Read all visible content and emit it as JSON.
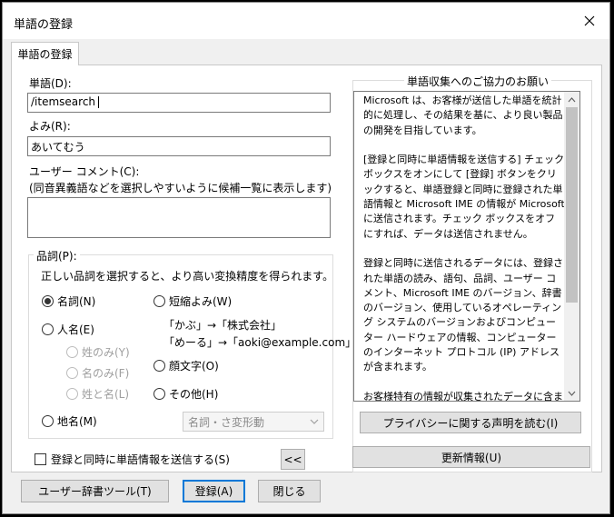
{
  "window": {
    "title": "単語の登録"
  },
  "tab": {
    "label": "単語の登録"
  },
  "word": {
    "label": "単語(D):",
    "value": "/itemsearch"
  },
  "reading": {
    "label": "よみ(R):",
    "value": "あいてむう"
  },
  "comment": {
    "label": "ユーザー コメント(C):",
    "hint": "(同音異義語などを選択しやすいように候補一覧に表示します)",
    "value": ""
  },
  "pos": {
    "title": "品詞(P):",
    "description": "正しい品詞を選択すると、より高い変換精度を得られます。",
    "noun": "名詞(N)",
    "person": "人名(E)",
    "surname_only": "姓のみ(Y)",
    "given_only": "名のみ(F)",
    "surname_given": "姓と名(L)",
    "place": "地名(M)",
    "abbrev": "短縮よみ(W)",
    "abbrev_example1": "「かぶ」→「株式会社」",
    "abbrev_example2": "「めーる」→「aoki@example.com」",
    "emoticon": "顔文字(O)",
    "other": "その他(H)",
    "subtype_value": "名詞・さ変形動"
  },
  "send_checkbox": {
    "label": "登録と同時に単語情報を送信する(S)"
  },
  "collapse_button": {
    "label": "<<"
  },
  "info": {
    "title": "単語収集へのご協力のお願い",
    "paragraphs": [
      "Microsoft は、お客様が送信した単語を統計的に処理し、その結果を基に、より良い製品の開発を目指しています。",
      "[登録と同時に単語情報を送信する] チェック ボックスをオンにして [登録] ボタンをクリックすると、単語登録と同時に登録された単語情報と Microsoft IME の情報が Microsoft に送信されます。チェック ボックスをオフにすれば、データは送信されません。",
      "登録と同時に送信されるデータには、登録された単語の読み、語句、品詞、ユーザー コメント、Microsoft IME のバージョン、辞書のバージョン、使用しているオペレーティング システムのバージョンおよびコンピューター ハードウェアの情報、コンピューターのインターネット プロトコル (IP) アドレスが含まれます。",
      "お客様特有の情報が収集されたデータに含まれることがあります。このような情報が存在する場合でも、Microsoft では、お客様を特定するために使用することはありません。"
    ],
    "privacy_button": "プライバシーに関する声明を読む(I)",
    "update_button": "更新情報(U)"
  },
  "footer": {
    "user_dict_button": "ユーザー辞書ツール(T)",
    "register_button": "登録(A)",
    "close_button": "閉じる"
  }
}
